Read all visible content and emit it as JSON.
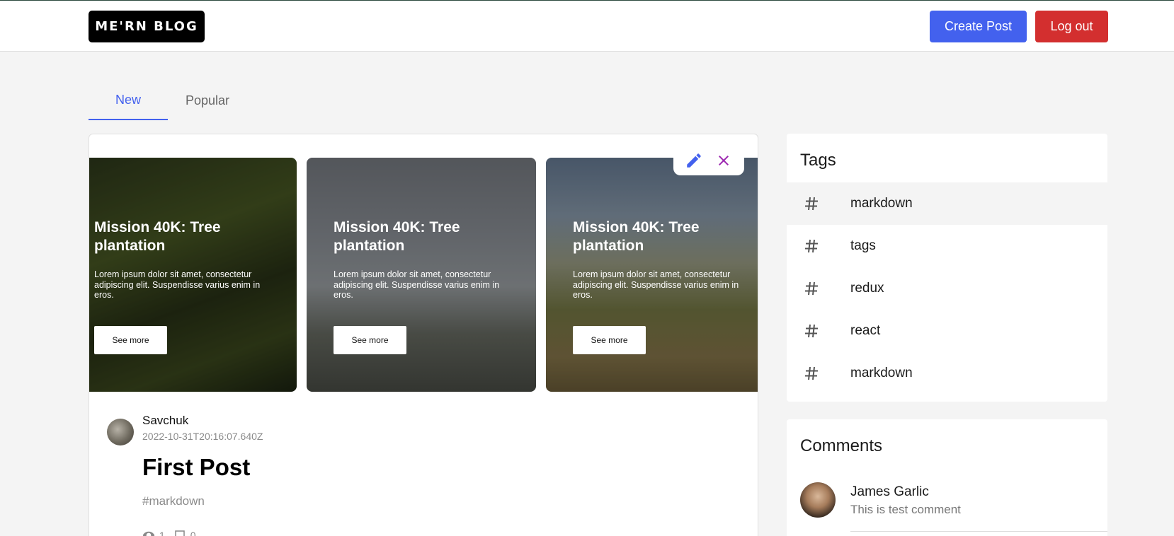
{
  "header": {
    "logo": "ME'RN BLOG",
    "create_post_label": "Create Post",
    "logout_label": "Log out"
  },
  "tabs": [
    {
      "label": "New",
      "active": true
    },
    {
      "label": "Popular",
      "active": false
    }
  ],
  "post": {
    "slides": [
      {
        "title": "Mission 40K: Tree plantation",
        "text": "Lorem ipsum dolor sit amet, consectetur adipiscing elit. Suspendisse varius enim in eros.",
        "button": "See more"
      },
      {
        "title": "Mission 40K: Tree plantation",
        "text": "Lorem ipsum dolor sit amet, consectetur adipiscing elit. Suspendisse varius enim in eros.",
        "button": "See more"
      },
      {
        "title": "Mission 40K: Tree plantation",
        "text": "Lorem ipsum dolor sit amet, consectetur adipiscing elit. Suspendisse varius enim in eros.",
        "button": "See more"
      }
    ],
    "author": "Savchuk",
    "date": "2022-10-31T20:16:07.640Z",
    "title": "First Post",
    "tag": "#markdown",
    "views": "1",
    "comments_count": "0"
  },
  "tags_panel": {
    "title": "Tags",
    "items": [
      "markdown",
      "tags",
      "redux",
      "react",
      "markdown"
    ]
  },
  "comments_panel": {
    "title": "Comments",
    "items": [
      {
        "name": "James Garlic",
        "text": "This is test comment"
      }
    ]
  },
  "colors": {
    "accent": "#4361ee",
    "danger": "#d32f2f",
    "edit_icon": "#4361ee",
    "delete_icon": "#9c27b0"
  }
}
